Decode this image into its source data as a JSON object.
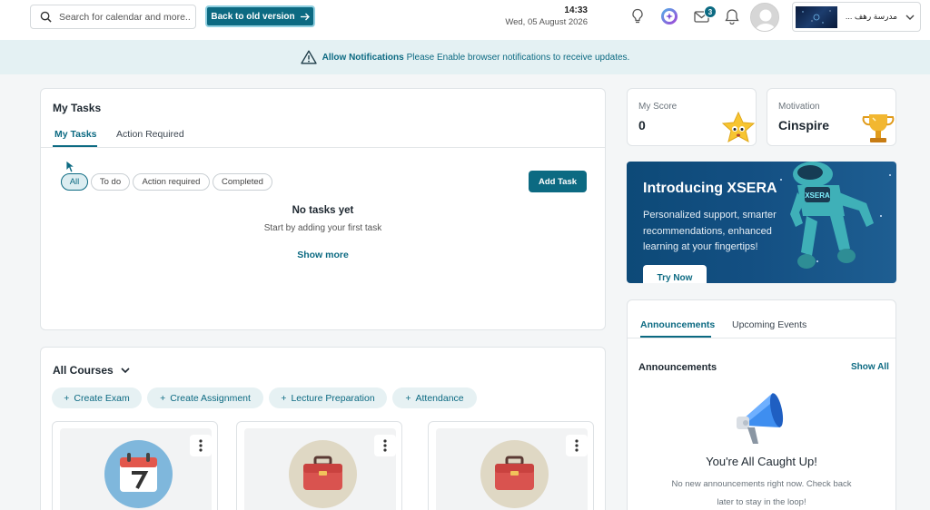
{
  "header": {
    "search_placeholder": "Search for calendar and more..",
    "back_button_label": "Back to old version",
    "time": "14:33",
    "date": "Wed, 05 August 2026",
    "mail_badge_count": "3",
    "school_name": "مدرسة رهف ..."
  },
  "notification_bar": {
    "title": "Allow Notifications",
    "message": "Please Enable browser notifications to receive updates."
  },
  "tasks": {
    "title": "My Tasks",
    "tabs": [
      "My Tasks",
      "Action Required"
    ],
    "filters": [
      "All",
      "To do",
      "Action required",
      "Completed"
    ],
    "add_button": "Add Task",
    "empty_title": "No tasks yet",
    "empty_subtitle": "Start by adding your first task",
    "show_more": "Show more"
  },
  "courses": {
    "title": "All Courses",
    "quick_actions": [
      "Create Exam",
      "Create Assignment",
      "Lecture Preparation",
      "Attendance"
    ]
  },
  "score": {
    "label": "My Score",
    "value": "0"
  },
  "motivation": {
    "label": "Motivation",
    "value": "Cinspire"
  },
  "banner": {
    "title": "Introducing XSERA",
    "text": "Personalized support, smarter recommendations, enhanced learning at your fingertips!",
    "robot_label": "XSERA",
    "button": "Try Now"
  },
  "announcements": {
    "tabs": [
      "Announcements",
      "Upcoming Events"
    ],
    "heading": "Announcements",
    "show_all": "Show All",
    "caught_up": "You're All Caught Up!",
    "subtitle": "No new announcements right now. Check back later to stay in the loop!"
  },
  "colors": {
    "primary": "#0c6a82",
    "notif_bg": "#e4f1f3",
    "page_bg": "#f4f6f7"
  }
}
